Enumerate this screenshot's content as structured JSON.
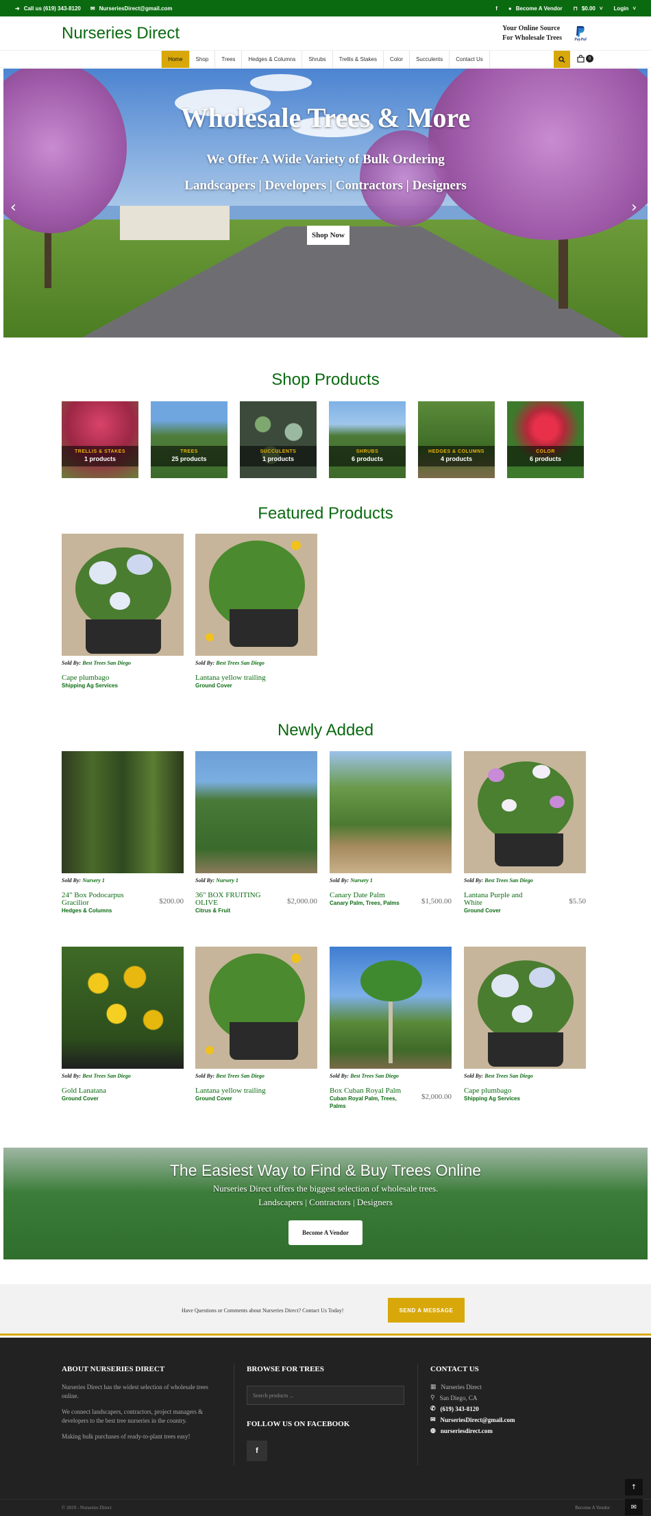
{
  "topbar": {
    "phone": "Call us (619) 343-8120",
    "email": "NurseriesDirect@gmail.com",
    "become_vendor": "Become A Vendor",
    "cart_total": "$0.00",
    "login": "Login"
  },
  "header": {
    "logo": "Nurseries Direct",
    "tagline_line1": "Your Online Source",
    "tagline_line2": "For Wholesale Trees",
    "paypal": "PayPal"
  },
  "nav": {
    "items": [
      "Home",
      "Shop",
      "Trees",
      "Hedges & Columns",
      "Shrubs",
      "Trellis & Stakes",
      "Color",
      "Succulents",
      "Contact Us"
    ],
    "cart_count": "0"
  },
  "hero": {
    "title": "Wholesale Trees & More",
    "subtitle": "We Offer A Wide Variety of Bulk Ordering",
    "audience": "Landscapers | Developers | Contractors | Designers",
    "cta": "Shop Now"
  },
  "shop_products": {
    "title": "Shop Products",
    "categories": [
      {
        "name": "TRELLIS & STAKES",
        "count": "1 products"
      },
      {
        "name": "TREES",
        "count": "25 products"
      },
      {
        "name": "SUCCULENTS",
        "count": "1 products"
      },
      {
        "name": "SHRUBS",
        "count": "6 products"
      },
      {
        "name": "HEDGES & COLUMNS",
        "count": "4 products"
      },
      {
        "name": "COLOR",
        "count": "6 products"
      }
    ]
  },
  "featured": {
    "title": "Featured Products",
    "sold_by_label": "Sold By:",
    "items": [
      {
        "vendor": "Best Trees San Diego",
        "name": "Cape plumbago",
        "cats": "Shipping Ag Services",
        "price": ""
      },
      {
        "vendor": "Best Trees San Diego",
        "name": "Lantana yellow trailing",
        "cats": "Ground Cover",
        "price": ""
      }
    ]
  },
  "newly_added": {
    "title": "Newly Added",
    "sold_by_label": "Sold By:",
    "items": [
      {
        "vendor": "Nursery 1",
        "name": "24\" Box Podocarpus Gracilior",
        "cats": "Hedges & Columns",
        "price": "$200.00"
      },
      {
        "vendor": "Nursery 1",
        "name": "36\" BOX FRUITING OLIVE",
        "cats": "Citrus & Fruit",
        "price": "$2,000.00"
      },
      {
        "vendor": "Nursery 1",
        "name": "Canary Date Palm",
        "cats": "Canary Palm, Trees, Palms",
        "price": "$1,500.00"
      },
      {
        "vendor": "Best Trees San Diego",
        "name": "Lantana Purple and White",
        "cats": "Ground Cover",
        "price": "$5.50"
      },
      {
        "vendor": "Best Trees San Diego",
        "name": "Gold Lanatana",
        "cats": "Ground Cover",
        "price": ""
      },
      {
        "vendor": "Best Trees San Diego",
        "name": "Lantana yellow trailing",
        "cats": "Ground Cover",
        "price": ""
      },
      {
        "vendor": "Best Trees San Diego",
        "name": "Box Cuban Royal Palm",
        "cats": "Cuban Royal Palm, Trees, Palms",
        "price": "$2,000.00"
      },
      {
        "vendor": "Best Trees San Diego",
        "name": "Cape plumbago",
        "cats": "Shipping Ag Services",
        "price": ""
      }
    ]
  },
  "banner": {
    "title": "The Easiest Way to Find & Buy Trees Online",
    "line1": "Nurseries Direct offers the biggest selection of wholesale trees.",
    "line2": "Landscapers | Contractors | Designers",
    "cta": "Become A Vendor"
  },
  "contact_strip": {
    "question": "Have Questions or Comments about Nurseries Direct? Contact Us Today!",
    "cta": "SEND A MESSAGE"
  },
  "footer": {
    "about_title": "About Nurseries Direct",
    "about_p1": "Nurseries Direct has the widest selection of wholesale trees online.",
    "about_p2": "We connect landscapers, contractors, project managers & developers to the best tree nurseries in the country.",
    "about_p3": "Making bulk purchases of ready-to-plant trees easy!",
    "browse_title": "Browse For Trees",
    "search_placeholder": "Search products ...",
    "follow_title": "Follow Us On Facebook",
    "contact_title": "Contact Us",
    "contact_name": "Nurseries Direct",
    "contact_location": "San Diego, CA",
    "contact_phone": "(619) 343-8120",
    "contact_email": "NurseriesDirect@gmail.com",
    "contact_site": "nurseriesdirect.com",
    "copyright": "© 2019 - Nurseries Direct",
    "become_vendor": "Become A Vendor"
  },
  "colors": {
    "brand_green": "#0a6a10",
    "accent_gold": "#d8a80a",
    "footer_bg": "#222222"
  }
}
